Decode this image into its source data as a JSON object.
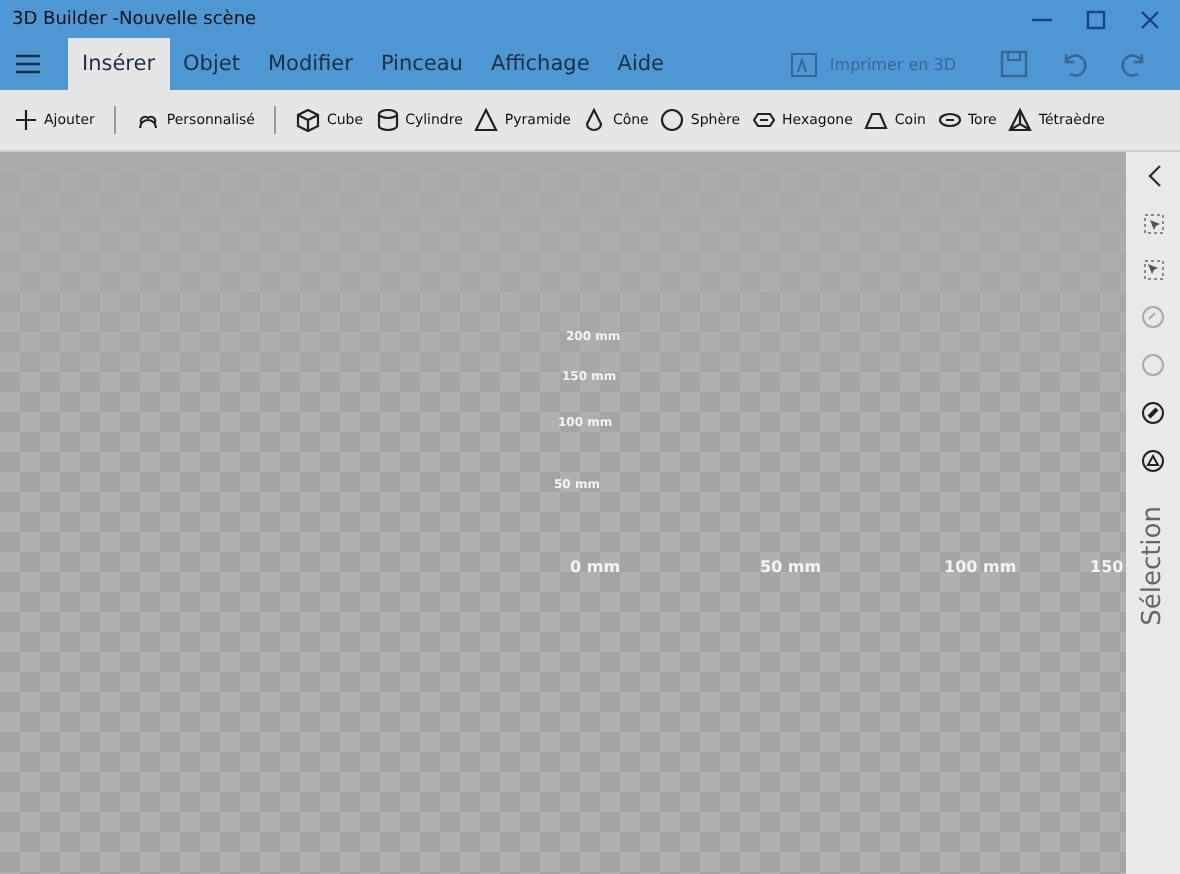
{
  "window": {
    "title": "3D Builder -Nouvelle scène"
  },
  "tabs": [
    {
      "label": "Insérer",
      "selected": true
    },
    {
      "label": "Objet",
      "selected": false
    },
    {
      "label": "Modifier",
      "selected": false
    },
    {
      "label": "Pinceau",
      "selected": false
    },
    {
      "label": "Affichage",
      "selected": false
    },
    {
      "label": "Aide",
      "selected": false
    }
  ],
  "actions": [
    {
      "label": "Imprimer en 3D",
      "disabled": true
    },
    {
      "kind": "save",
      "disabled": true
    },
    {
      "kind": "undo",
      "disabled": true
    },
    {
      "kind": "redo",
      "disabled": true
    }
  ],
  "toolbar": [
    [
      "Ajouter"
    ],
    [
      "Personnalisé"
    ],
    [
      "Cube",
      "Cylindre",
      "Pyramide",
      "Cône",
      "Sphère",
      "Hexagone",
      "Coin",
      "Tore",
      "Tétraèdre"
    ]
  ],
  "canvas": {
    "x_labels": [
      "0 mm",
      "50 mm",
      "100 mm",
      "150"
    ],
    "y_labels": [
      "200 mm",
      "150 mm",
      "100 mm",
      "50 mm"
    ]
  },
  "sidebar": {
    "label": "Sélection"
  }
}
